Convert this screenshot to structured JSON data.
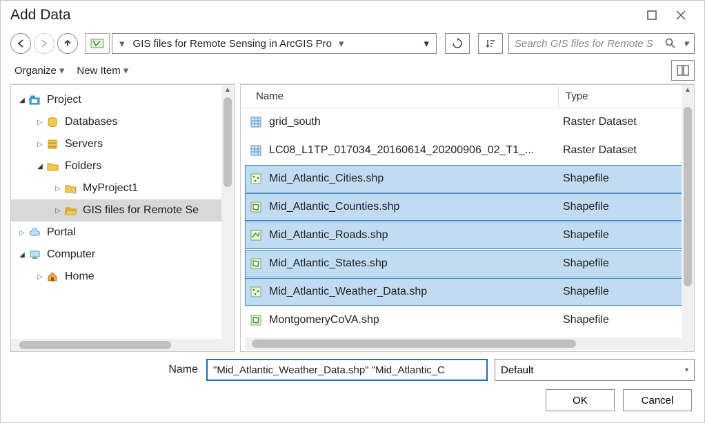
{
  "title": "Add Data",
  "nav": {
    "breadcrumb": "GIS files for Remote Sensing in ArcGIS Pro",
    "search_placeholder": "Search GIS files for Remote S"
  },
  "toolbar": {
    "organize": "Organize",
    "newitem": "New Item"
  },
  "tree": {
    "items": [
      {
        "label": "Project",
        "depth": 0,
        "expanded": true,
        "icon": "project",
        "expander": true
      },
      {
        "label": "Databases",
        "depth": 1,
        "expanded": false,
        "icon": "database",
        "expander": true
      },
      {
        "label": "Servers",
        "depth": 1,
        "expanded": false,
        "icon": "server",
        "expander": true
      },
      {
        "label": "Folders",
        "depth": 1,
        "expanded": true,
        "icon": "folder",
        "expander": true
      },
      {
        "label": "MyProject1",
        "depth": 2,
        "expanded": false,
        "icon": "folder-home",
        "expander": true
      },
      {
        "label": "GIS files for Remote Se",
        "depth": 2,
        "expanded": false,
        "icon": "folder-open",
        "expander": true,
        "selected": true
      },
      {
        "label": "Portal",
        "depth": 0,
        "expanded": false,
        "icon": "cloud",
        "expander": true
      },
      {
        "label": "Computer",
        "depth": 0,
        "expanded": true,
        "icon": "computer",
        "expander": true
      },
      {
        "label": "Home",
        "depth": 1,
        "expanded": false,
        "icon": "house",
        "expander": true
      }
    ]
  },
  "columns": {
    "name": "Name",
    "type": "Type"
  },
  "files": [
    {
      "name": "grid_south",
      "type": "Raster Dataset",
      "icon": "raster",
      "selected": false
    },
    {
      "name": "LC08_L1TP_017034_20160614_20200906_02_T1_...",
      "type": "Raster Dataset",
      "icon": "raster",
      "selected": false
    },
    {
      "name": "Mid_Atlantic_Cities.shp",
      "type": "Shapefile",
      "icon": "point",
      "selected": true
    },
    {
      "name": "Mid_Atlantic_Counties.shp",
      "type": "Shapefile",
      "icon": "polygon",
      "selected": true
    },
    {
      "name": "Mid_Atlantic_Roads.shp",
      "type": "Shapefile",
      "icon": "line",
      "selected": true
    },
    {
      "name": "Mid_Atlantic_States.shp",
      "type": "Shapefile",
      "icon": "polygon",
      "selected": true
    },
    {
      "name": "Mid_Atlantic_Weather_Data.shp",
      "type": "Shapefile",
      "icon": "point",
      "selected": true
    },
    {
      "name": "MontgomeryCoVA.shp",
      "type": "Shapefile",
      "icon": "polygon",
      "selected": false
    }
  ],
  "footer": {
    "name_label": "Name",
    "name_value": "\"Mid_Atlantic_Weather_Data.shp\" \"Mid_Atlantic_C",
    "filter": "Default",
    "ok": "OK",
    "cancel": "Cancel"
  }
}
